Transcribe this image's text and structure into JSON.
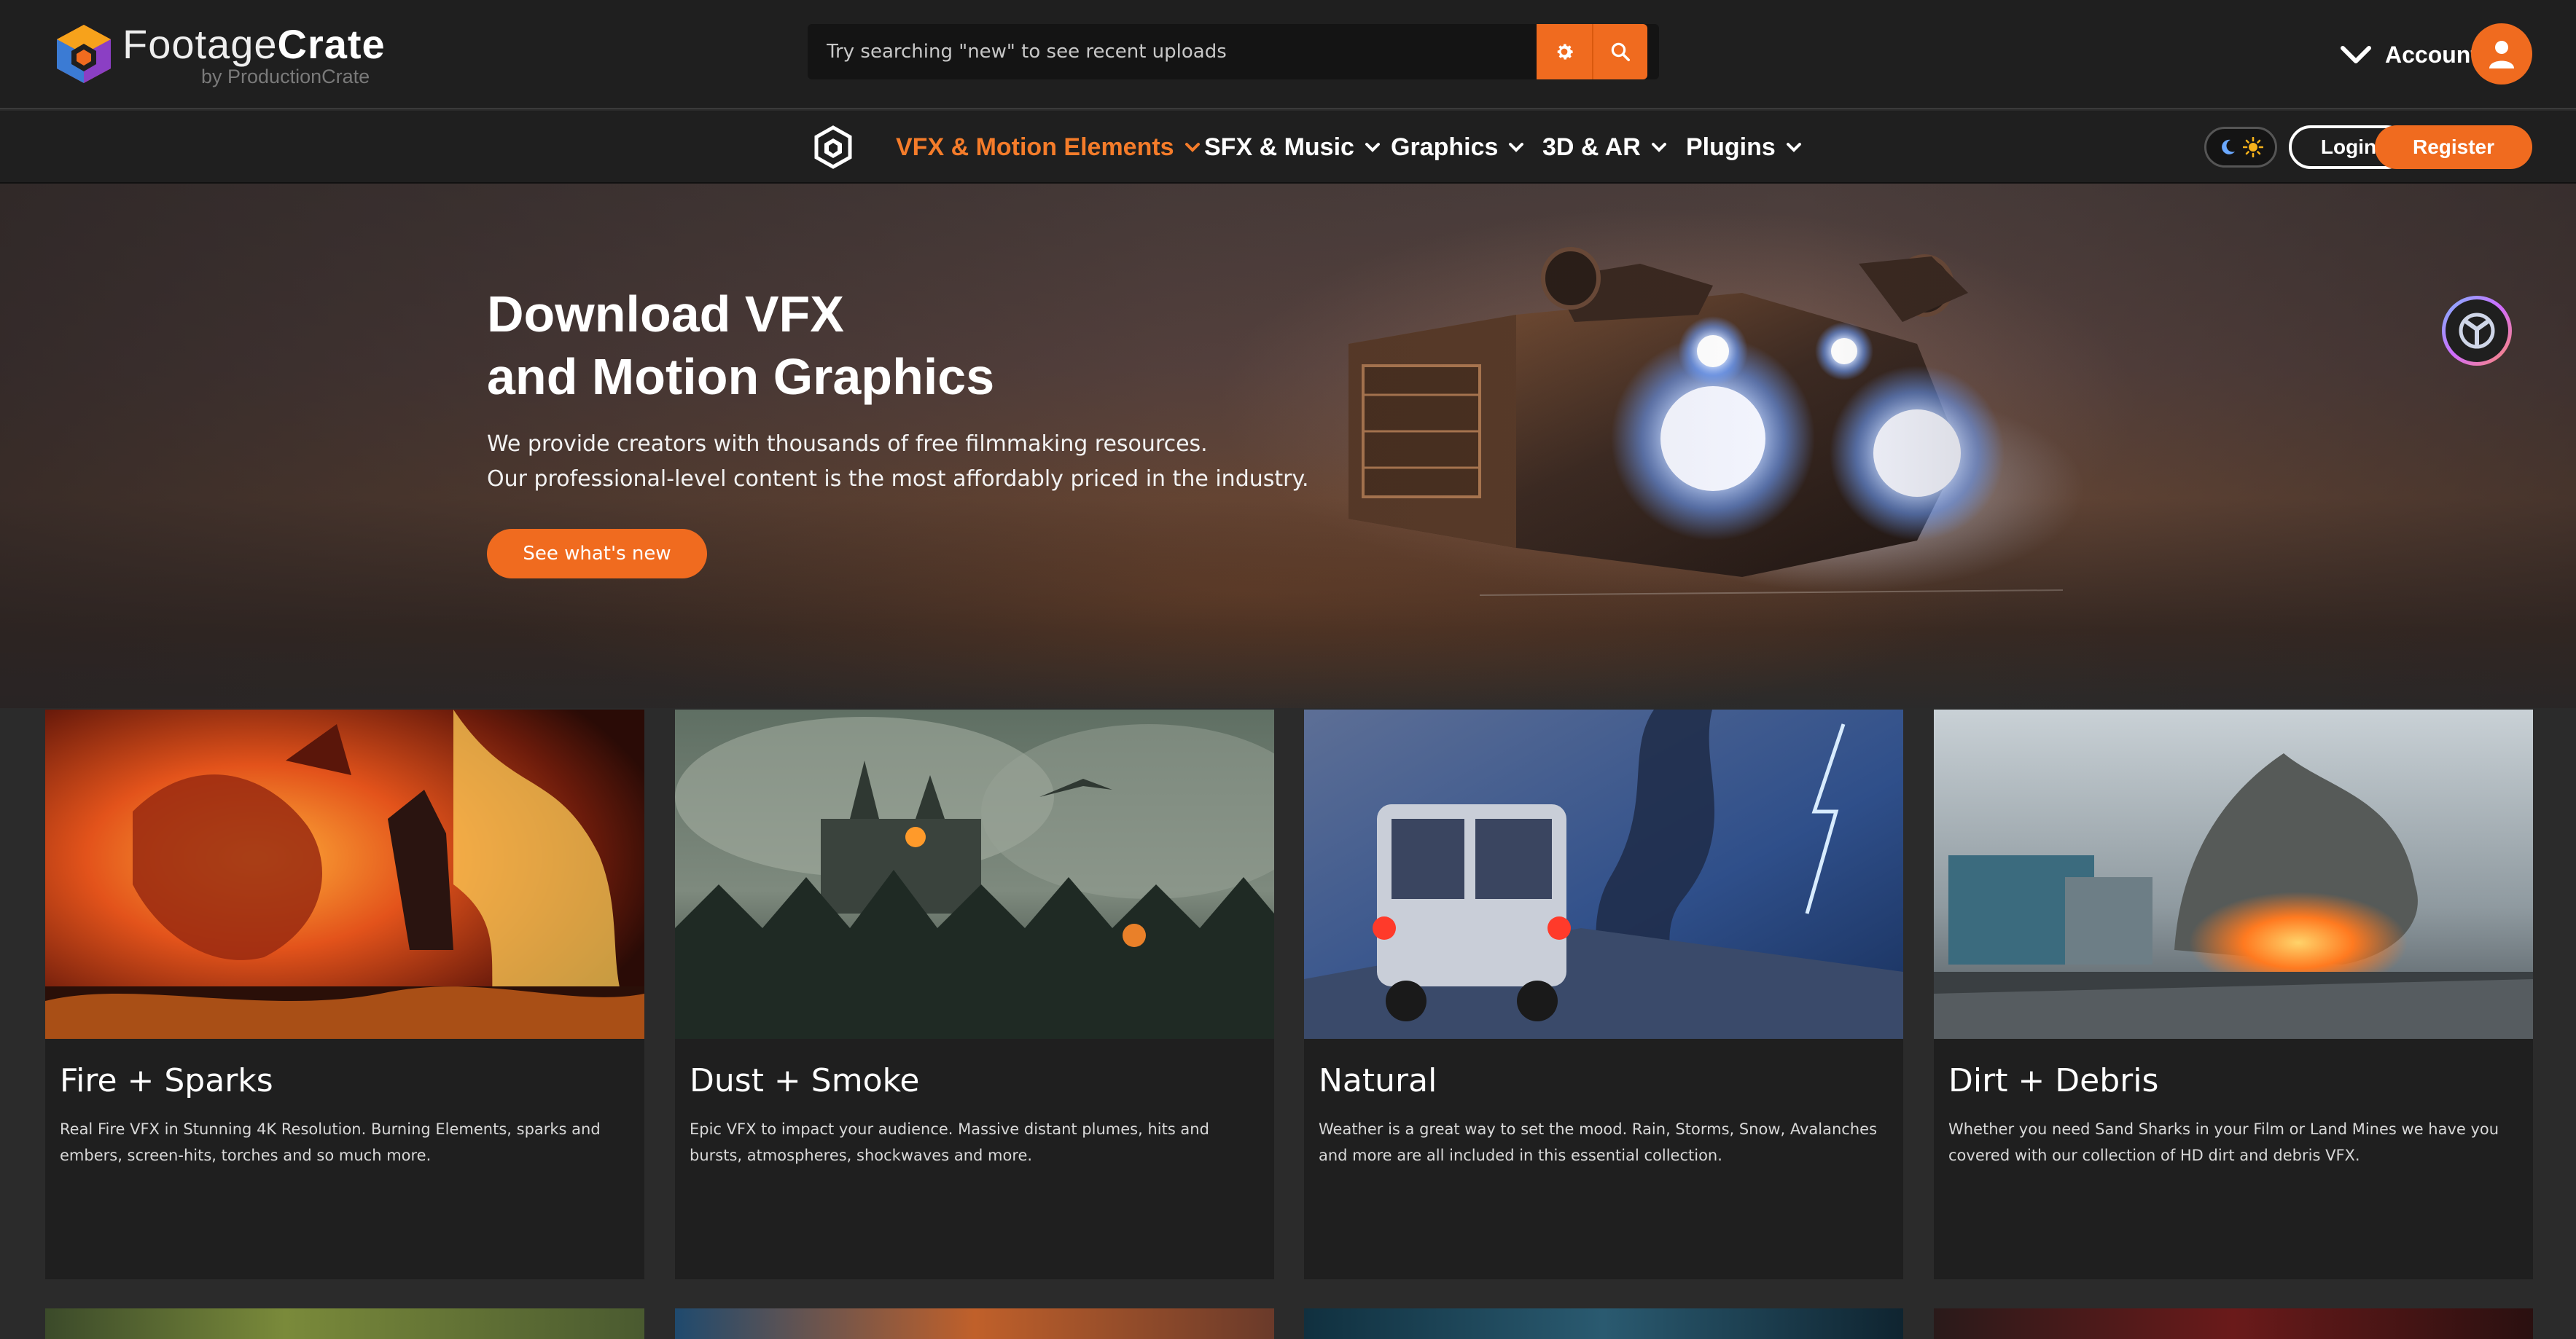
{
  "brand": {
    "name_light": "Footage",
    "name_bold": "Crate",
    "sub": "by ProductionCrate"
  },
  "search": {
    "placeholder": "Try searching \"new\" to see recent uploads"
  },
  "account": {
    "label": "Account"
  },
  "nav": {
    "items": [
      {
        "label": "VFX & Motion Elements",
        "active": true
      },
      {
        "label": "SFX & Music"
      },
      {
        "label": "Graphics"
      },
      {
        "label": "3D & AR"
      },
      {
        "label": "Plugins"
      }
    ],
    "login": "Login",
    "register": "Register"
  },
  "hero": {
    "title_line1": "Download VFX",
    "title_line2": "and Motion Graphics",
    "text_line1": "We provide creators with thousands of free filmmaking resources.",
    "text_line2": "Our professional-level content is the most affordably priced in the industry.",
    "cta": "See what's new"
  },
  "cards": [
    {
      "title": "Fire + Sparks",
      "desc": "Real Fire VFX in Stunning 4K Resolution. Burning Elements, sparks and embers, screen-hits, torches and so much more."
    },
    {
      "title": "Dust + Smoke",
      "desc": "Epic VFX to impact your audience. Massive distant plumes, hits and bursts, atmospheres, shockwaves and more."
    },
    {
      "title": "Natural",
      "desc": "Weather is a great way to set the mood. Rain, Storms, Snow, Avalanches and more are all included in this essential collection."
    },
    {
      "title": "Dirt + Debris",
      "desc": "Whether you need Sand Sharks in your Film or Land Mines we have you covered with our collection of HD dirt and debris VFX."
    }
  ],
  "colors": {
    "accent": "#f06b1f",
    "nav_active": "#f57c2a",
    "header_bg": "#1f1f1f",
    "page_bg": "#2b2b2b"
  },
  "icons": [
    "logo-cube-icon",
    "gear-icon",
    "search-icon",
    "chevron-down-icon",
    "user-icon",
    "moon-icon",
    "sun-icon",
    "crate-mark-icon"
  ]
}
